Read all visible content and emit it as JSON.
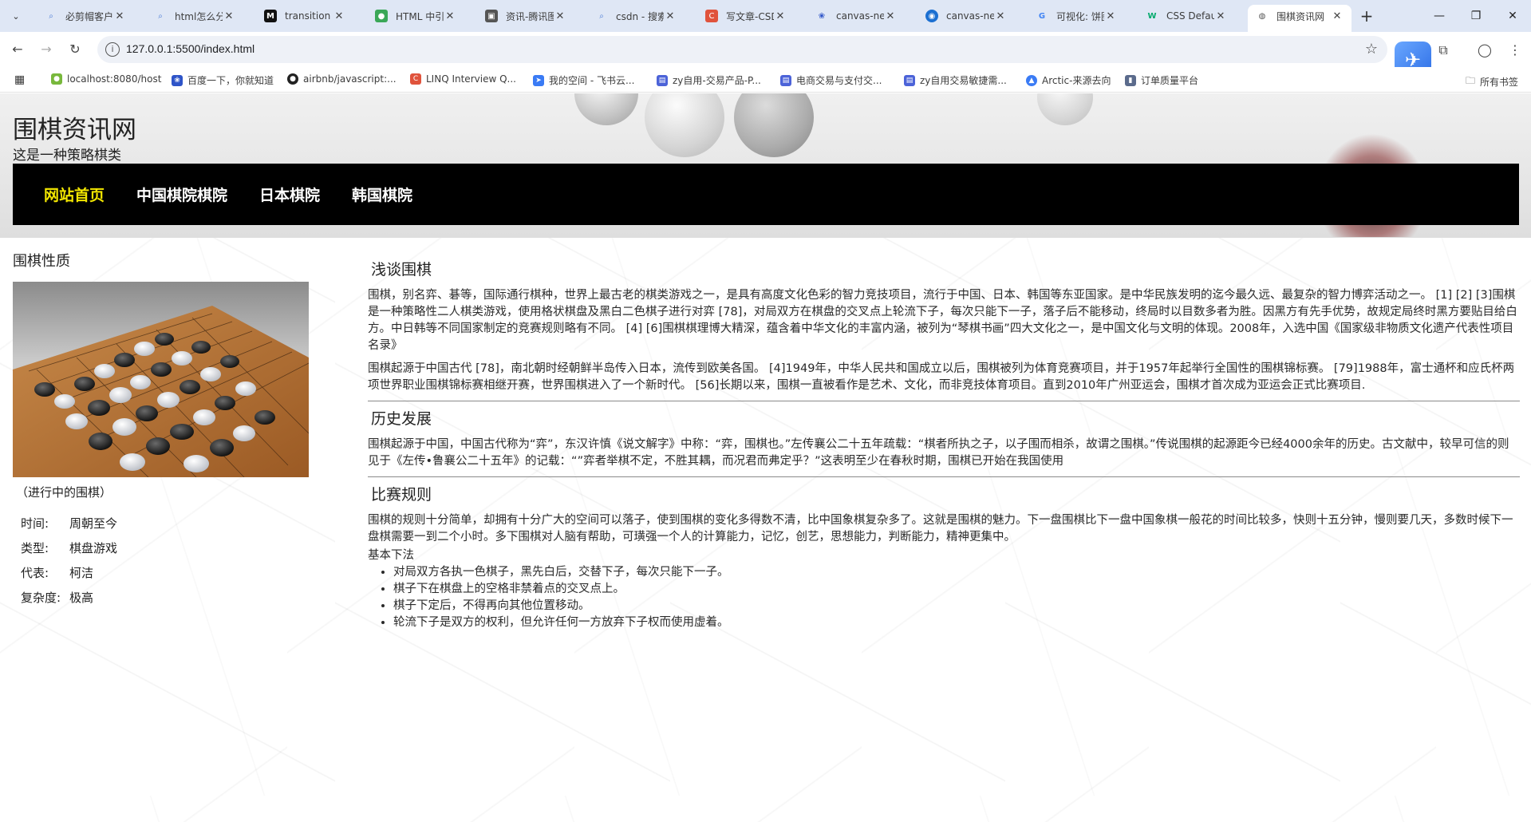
{
  "browser": {
    "tabs": [
      {
        "title": "必剪帽客户端",
        "icon": "search-icon",
        "color": "#4a7bd6"
      },
      {
        "title": "html怎么分",
        "icon": "search-icon",
        "color": "#4a7bd6"
      },
      {
        "title": "transition -",
        "icon": "m-icon",
        "color": "#111111"
      },
      {
        "title": "HTML 中引入",
        "icon": "leaf-icon",
        "color": "#3aa757"
      },
      {
        "title": "资讯-腾讯图",
        "icon": "image-icon",
        "color": "#555555"
      },
      {
        "title": "csdn - 搜索",
        "icon": "search-icon",
        "color": "#4a7bd6"
      },
      {
        "title": "写文章-CSD",
        "icon": "csdn-icon",
        "color": "#e0533c"
      },
      {
        "title": "canvas-nest",
        "icon": "paw-icon",
        "color": "#2e54c8"
      },
      {
        "title": "canvas-nest",
        "icon": "circle-icon",
        "color": "#1b6fd1"
      },
      {
        "title": "可视化: 饼图",
        "icon": "google-icon",
        "color": "#4285f4"
      },
      {
        "title": "CSS Default",
        "icon": "w3-icon",
        "color": "#04aa6d"
      },
      {
        "title": "围棋资讯网",
        "icon": "globe-icon",
        "color": "#666666",
        "active": true
      }
    ],
    "url": "127.0.0.1:5500/index.html",
    "bookmarks": [
      {
        "label": "localhost:8080/host",
        "color": "#78b83c"
      },
      {
        "label": "百度一下，你就知道",
        "color": "#2e54c8"
      },
      {
        "label": "airbnb/javascript:...",
        "color": "#222222"
      },
      {
        "label": "LINQ Interview Q...",
        "color": "#e0533c"
      },
      {
        "label": "我的空间 - 飞书云...",
        "color": "#3a7bf5"
      },
      {
        "label": "zy自用-交易产品-P...",
        "color": "#4c63d8"
      },
      {
        "label": "电商交易与支付交...",
        "color": "#4c63d8"
      },
      {
        "label": "zy自用交易敏捷需...",
        "color": "#4c63d8"
      },
      {
        "label": "Arctic-来源去向",
        "color": "#3a7bf5"
      },
      {
        "label": "订单质量平台",
        "color": "#5b6b8c"
      }
    ],
    "all_bookmarks": "所有书签"
  },
  "site": {
    "title": "围棋资讯网",
    "subtitle": "这是一种策略棋类",
    "nav": [
      "网站首页",
      "中国棋院棋院",
      "日本棋院",
      "韩国棋院"
    ]
  },
  "aside": {
    "heading": "围棋性质",
    "caption": "（进行中的围棋）",
    "facts": [
      {
        "k": "时间:",
        "v": "周朝至今"
      },
      {
        "k": "类型:",
        "v": "棋盘游戏"
      },
      {
        "k": "代表:",
        "v": "柯洁"
      },
      {
        "k": "复杂度:",
        "v": "极高"
      }
    ]
  },
  "sections": {
    "s1": {
      "title": "浅谈围棋",
      "p1": "围棋，别名弈、碁等，国际通行棋种，世界上最古老的棋类游戏之一，是具有高度文化色彩的智力竞技项目，流行于中国、日本、韩国等东亚国家。是中华民族发明的迄今最久远、最复杂的智力博弈活动之一。 [1] [2] [3]围棋是一种策略性二人棋类游戏，使用格状棋盘及黑白二色棋子进行对弈 [78]，对局双方在棋盘的交叉点上轮流下子，每次只能下一子，落子后不能移动，终局时以目数多者为胜。因黑方有先手优势，故规定局终时黑方要贴目给白方。中日韩等不同国家制定的竞赛规则略有不同。 [4] [6]围棋棋理博大精深，蕴含着中华文化的丰富内涵，被列为“琴棋书画”四大文化之一，是中国文化与文明的体现。2008年，入选中国《国家级非物质文化遗产代表性项目名录》",
      "p2": "围棋起源于中国古代 [78]，南北朝时经朝鲜半岛传入日本，流传到欧美各国。 [4]1949年，中华人民共和国成立以后，围棋被列为体育竞赛项目，并于1957年起举行全国性的围棋锦标赛。 [79]1988年，富士通杯和应氏杯两项世界职业围棋锦标赛相继开赛，世界围棋进入了一个新时代。 [56]长期以来，围棋一直被看作是艺术、文化，而非竞技体育项目。直到2010年广州亚运会，围棋才首次成为亚运会正式比赛项目."
    },
    "s2": {
      "title": "历史发展",
      "p1": "围棋起源于中国，中国古代称为“弈”，东汉许慎《说文解字》中称：“弈，围棋也。”左传襄公二十五年疏载：“棋者所执之子，以子围而相杀，故谓之围棋。”传说围棋的起源距今已经4000余年的历史。古文献中，较早可信的则见于《左传•鲁襄公二十五年》的记载：“”弈者举棋不定，不胜其耦，而况君而弗定乎？”这表明至少在春秋时期，围棋已开始在我国使用"
    },
    "s3": {
      "title": "比赛规则",
      "p1": "围棋的规则十分简单，却拥有十分广大的空间可以落子，使到围棋的变化多得数不清，比中国象棋复杂多了。这就是围棋的魅力。下一盘围棋比下一盘中国象棋一般花的时间比较多，快则十五分钟，慢则要几天，多数时候下一盘棋需要一到二个小时。多下围棋对人脑有帮助，可璜强一个人的计算能力，记忆，创艺，思想能力，判断能力，精神更集中。",
      "basic_label": "基本下法",
      "rules": [
        "对局双方各执一色棋子，黑先白后，交替下子，每次只能下一子。",
        "棋子下在棋盘上的空格非禁着点的交叉点上。",
        "棋子下定后，不得再向其他位置移动。",
        "轮流下子是双方的权利，但允许任何一方放弃下子权而使用虚着。"
      ]
    }
  }
}
